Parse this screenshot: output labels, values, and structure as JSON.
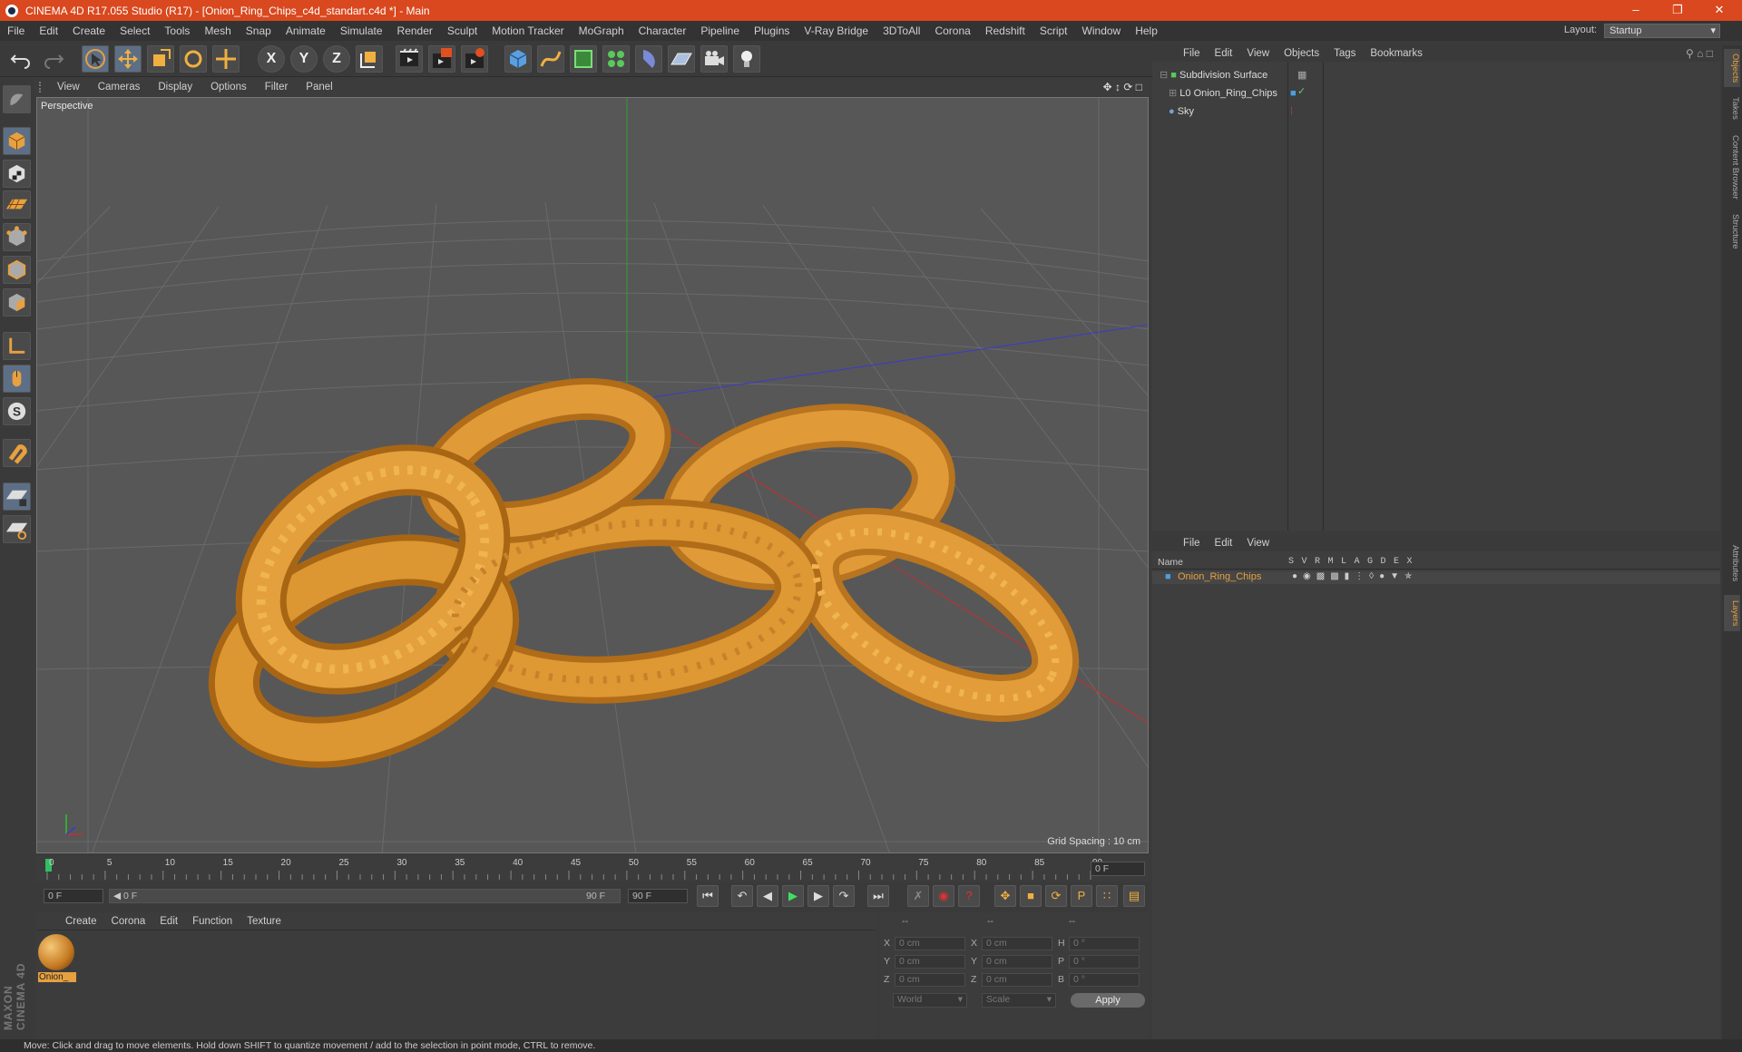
{
  "window": {
    "title": "CINEMA 4D R17.055 Studio (R17) - [Onion_Ring_Chips_c4d_standart.c4d *] - Main"
  },
  "menu": [
    "File",
    "Edit",
    "Create",
    "Select",
    "Tools",
    "Mesh",
    "Snap",
    "Animate",
    "Simulate",
    "Render",
    "Sculpt",
    "Motion Tracker",
    "MoGraph",
    "Character",
    "Pipeline",
    "Plugins",
    "V-Ray Bridge",
    "3DToAll",
    "Corona",
    "Redshift",
    "Script",
    "Window",
    "Help"
  ],
  "layout": {
    "label": "Layout:",
    "value": "Startup"
  },
  "toolbar": {
    "axis_x": "X",
    "axis_y": "Y",
    "axis_z": "Z"
  },
  "viewport": {
    "menu": [
      "View",
      "Cameras",
      "Display",
      "Options",
      "Filter",
      "Panel"
    ],
    "camera": "Perspective",
    "grid_spacing": "Grid Spacing : 10 cm"
  },
  "timeline": {
    "ticks": [
      "0",
      "5",
      "10",
      "15",
      "20",
      "25",
      "30",
      "35",
      "40",
      "45",
      "50",
      "55",
      "60",
      "65",
      "70",
      "75",
      "80",
      "85",
      "90"
    ],
    "end_field": "0 F",
    "start_field": "0 F",
    "range_start": "0 F",
    "range_end": "90 F",
    "max_field": "90 F"
  },
  "objects_panel": {
    "menu": [
      "File",
      "Edit",
      "View",
      "Objects",
      "Tags",
      "Bookmarks"
    ],
    "items": [
      {
        "name": "Subdivision Surface"
      },
      {
        "name": "Onion_Ring_Chips"
      },
      {
        "name": "Sky"
      }
    ]
  },
  "layers_panel": {
    "menu": [
      "File",
      "Edit",
      "View"
    ],
    "header_name": "Name",
    "columns": [
      "S",
      "V",
      "R",
      "M",
      "L",
      "A",
      "G",
      "D",
      "E",
      "X"
    ],
    "row_name": "Onion_Ring_Chips"
  },
  "material_panel": {
    "menu": [
      "Create",
      "Corona",
      "Edit",
      "Function",
      "Texture"
    ],
    "material_label": "Onion_"
  },
  "coordinates": {
    "headers": [
      "--",
      "--",
      "--"
    ],
    "rows": [
      {
        "a": "X",
        "av": "0 cm",
        "b": "X",
        "bv": "0 cm",
        "c": "H",
        "cv": "0 °"
      },
      {
        "a": "Y",
        "av": "0 cm",
        "b": "Y",
        "bv": "0 cm",
        "c": "P",
        "cv": "0 °"
      },
      {
        "a": "Z",
        "av": "0 cm",
        "b": "Z",
        "bv": "0 cm",
        "c": "B",
        "cv": "0 °"
      }
    ],
    "world": "World",
    "scale": "Scale",
    "apply": "Apply"
  },
  "side_tabs": [
    "Objects",
    "Takes",
    "Content Browser",
    "Structure",
    "Attributes",
    "Layers"
  ],
  "brand": "MAXON CINEMA 4D",
  "status": "Move: Click and drag to move elements. Hold down SHIFT to quantize movement / add to the selection in point mode, CTRL to remove.",
  "colors": {
    "titlebar": "#d9481e",
    "accent": "#e6a040",
    "ring": "#d89030"
  }
}
